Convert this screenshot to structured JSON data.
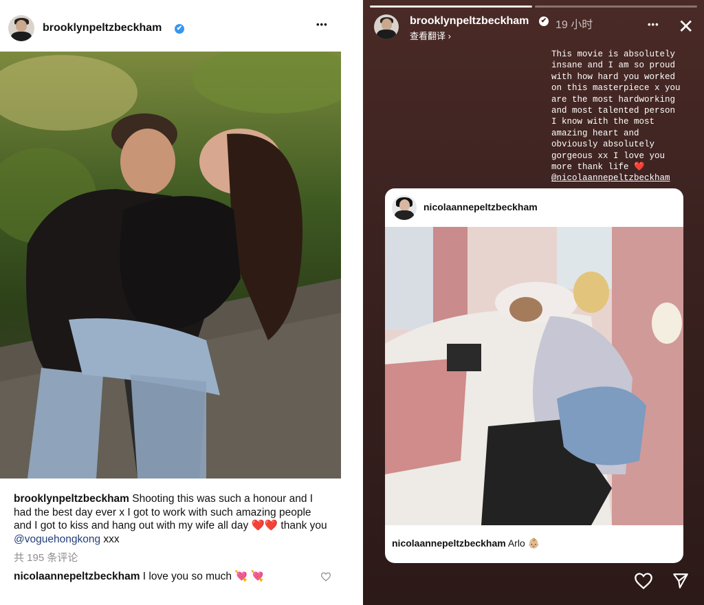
{
  "left_post": {
    "username": "brooklynpeltzbeckham",
    "verified_mark": "✔",
    "more_icon": "•••",
    "caption": {
      "username": "brooklynpeltzbeckham",
      "text_1": " Shooting this was such a honour and I had the best day ever x I got to work with such amazing people and I got to kiss and hang out with my wife all day ",
      "emoji": "❤️❤️",
      "text_2": " thank you ",
      "mention": "@voguehongkong",
      "text_3": " xxx"
    },
    "comment_count": "共 195 条评论",
    "comment": {
      "username": "nicolaannepeltzbeckham",
      "text": " I love you so much ",
      "emoji": "💘 💘"
    }
  },
  "right_story": {
    "username": "brooklynpeltzbeckham",
    "verified_mark": "✔",
    "time": "19 小时",
    "translate": "查看翻译 ›",
    "more_icon": "•••",
    "close_icon": "✕",
    "text": "This movie is absolutely\ninsane and I am so proud\nwith how hard you worked\non this masterpiece x you\nare the most hardworking\nand most talented person\nI know with the most\namazing heart and\nobviously absolutely\ngorgeous xx I love you\nmore thank life ❤️\n",
    "mention": "@nicolaannepeltzbeckham",
    "shared_post": {
      "username": "nicolaannepeltzbeckham",
      "caption_user": "nicolaannepeltzbeckham",
      "caption_text": " Arlo ",
      "caption_emoji": "👶🏼"
    }
  },
  "colors": {
    "verified": "#3797f0",
    "story_bg_top": "#4a2a26",
    "story_bg_bottom": "#2c1a18",
    "mention": "#233f7a"
  }
}
